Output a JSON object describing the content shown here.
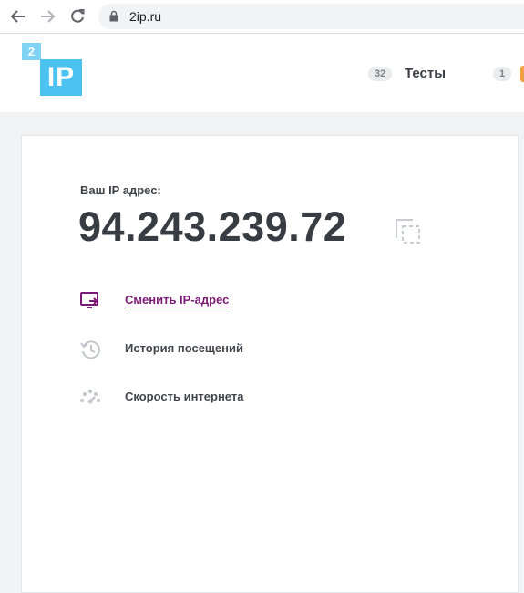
{
  "browser": {
    "url": "2ip.ru",
    "icons": [
      "back-icon",
      "forward-icon",
      "reload-icon",
      "lock-icon"
    ]
  },
  "header": {
    "logo": {
      "badge": "2",
      "main": "IP"
    },
    "tests_count": "32",
    "tests_label": "Тесты",
    "second_count": "1"
  },
  "main": {
    "ip_label": "Ваш IP адрес:",
    "ip_value": "94.243.239.72",
    "copy_icon": "copy-icon",
    "menu": [
      {
        "label": "Сменить IP-адрес",
        "icon": "change-ip-icon",
        "color": "#7b1a76"
      },
      {
        "label": "История посещений",
        "icon": "history-icon"
      },
      {
        "label": "Скорость интернета",
        "icon": "speedometer-icon"
      }
    ]
  },
  "colors": {
    "accent": "#7b1a76",
    "logo_blue": "#4cc2f0",
    "logo_light_blue": "#7fd3f4",
    "text_dark": "#383d44"
  }
}
